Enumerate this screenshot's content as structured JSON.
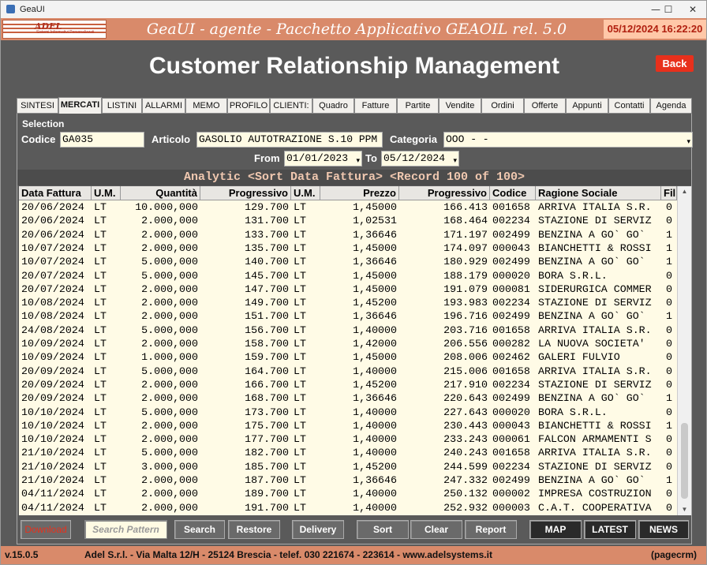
{
  "window": {
    "title": "GeaUI",
    "minimize": "—",
    "maximize": "☐",
    "close": "✕"
  },
  "header": {
    "logo_text": "ADEL",
    "logo_sub": "Sistemi Informativi Personalizzati",
    "app_title": "GeaUI - agente - Pacchetto Applicativo GEAOIL rel. 5.0",
    "datetime": "05/12/2024 16:22:20"
  },
  "page": {
    "title": "Customer Relationship Management",
    "back_label": "Back"
  },
  "tabs": [
    {
      "label": "SINTESI"
    },
    {
      "label": "MERCATI"
    },
    {
      "label": "LISTINI"
    },
    {
      "label": "ALLARMI"
    },
    {
      "label": "MEMO"
    },
    {
      "label": "PROFILO"
    },
    {
      "label": "CLIENTI:"
    },
    {
      "label": "Quadro"
    },
    {
      "label": "Fatture"
    },
    {
      "label": "Partite"
    },
    {
      "label": "Vendite"
    },
    {
      "label": "Ordini"
    },
    {
      "label": "Offerte"
    },
    {
      "label": "Appunti"
    },
    {
      "label": "Contatti"
    },
    {
      "label": "Agenda"
    }
  ],
  "selection": {
    "label": "Selection",
    "codice_label": "Codice",
    "codice_value": "GA035",
    "articolo_label": "Articolo",
    "articolo_value": "GASOLIO AUTOTRAZIONE S.10 PPM",
    "categoria_label": "Categoria",
    "categoria_value": "OOO - -",
    "from_label": "From",
    "from_value": "01/01/2023",
    "to_label": "To",
    "to_value": "05/12/2024"
  },
  "analytic_title": "Analytic <Sort Data Fattura> <Record 100 of 100>",
  "table": {
    "columns": [
      "Data Fattura",
      "U.M.",
      "Quantità",
      "Progressivo",
      "U.M.",
      "Prezzo",
      "Progressivo",
      "Codice",
      "Ragione Sociale",
      "Fil."
    ],
    "rows": [
      [
        "20/06/2024",
        "LT",
        "10.000,000",
        "129.700",
        "LT",
        "1,45000",
        "166.413",
        "001658",
        "ARRIVA ITALIA S.R.",
        "0"
      ],
      [
        "20/06/2024",
        "LT",
        "2.000,000",
        "131.700",
        "LT",
        "1,02531",
        "168.464",
        "002234",
        "STAZIONE DI SERVIZ",
        "0"
      ],
      [
        "20/06/2024",
        "LT",
        "2.000,000",
        "133.700",
        "LT",
        "1,36646",
        "171.197",
        "002499",
        "BENZINA A GO` GO`",
        "1"
      ],
      [
        "10/07/2024",
        "LT",
        "2.000,000",
        "135.700",
        "LT",
        "1,45000",
        "174.097",
        "000043",
        "BIANCHETTI & ROSSI",
        "1"
      ],
      [
        "10/07/2024",
        "LT",
        "5.000,000",
        "140.700",
        "LT",
        "1,36646",
        "180.929",
        "002499",
        "BENZINA A GO` GO`",
        "1"
      ],
      [
        "20/07/2024",
        "LT",
        "5.000,000",
        "145.700",
        "LT",
        "1,45000",
        "188.179",
        "000020",
        "BORA S.R.L.",
        "0"
      ],
      [
        "20/07/2024",
        "LT",
        "2.000,000",
        "147.700",
        "LT",
        "1,45000",
        "191.079",
        "000081",
        "SIDERURGICA COMMER",
        "0"
      ],
      [
        "10/08/2024",
        "LT",
        "2.000,000",
        "149.700",
        "LT",
        "1,45200",
        "193.983",
        "002234",
        "STAZIONE DI SERVIZ",
        "0"
      ],
      [
        "10/08/2024",
        "LT",
        "2.000,000",
        "151.700",
        "LT",
        "1,36646",
        "196.716",
        "002499",
        "BENZINA A GO` GO`",
        "1"
      ],
      [
        "24/08/2024",
        "LT",
        "5.000,000",
        "156.700",
        "LT",
        "1,40000",
        "203.716",
        "001658",
        "ARRIVA ITALIA S.R.",
        "0"
      ],
      [
        "10/09/2024",
        "LT",
        "2.000,000",
        "158.700",
        "LT",
        "1,42000",
        "206.556",
        "000282",
        "LA NUOVA SOCIETA'",
        "0"
      ],
      [
        "10/09/2024",
        "LT",
        "1.000,000",
        "159.700",
        "LT",
        "1,45000",
        "208.006",
        "002462",
        "GALERI FULVIO",
        "0"
      ],
      [
        "20/09/2024",
        "LT",
        "5.000,000",
        "164.700",
        "LT",
        "1,40000",
        "215.006",
        "001658",
        "ARRIVA ITALIA S.R.",
        "0"
      ],
      [
        "20/09/2024",
        "LT",
        "2.000,000",
        "166.700",
        "LT",
        "1,45200",
        "217.910",
        "002234",
        "STAZIONE DI SERVIZ",
        "0"
      ],
      [
        "20/09/2024",
        "LT",
        "2.000,000",
        "168.700",
        "LT",
        "1,36646",
        "220.643",
        "002499",
        "BENZINA A GO` GO`",
        "1"
      ],
      [
        "10/10/2024",
        "LT",
        "5.000,000",
        "173.700",
        "LT",
        "1,40000",
        "227.643",
        "000020",
        "BORA S.R.L.",
        "0"
      ],
      [
        "10/10/2024",
        "LT",
        "2.000,000",
        "175.700",
        "LT",
        "1,40000",
        "230.443",
        "000043",
        "BIANCHETTI & ROSSI",
        "1"
      ],
      [
        "10/10/2024",
        "LT",
        "2.000,000",
        "177.700",
        "LT",
        "1,40000",
        "233.243",
        "000061",
        "FALCON ARMAMENTI S",
        "0"
      ],
      [
        "21/10/2024",
        "LT",
        "5.000,000",
        "182.700",
        "LT",
        "1,40000",
        "240.243",
        "001658",
        "ARRIVA ITALIA S.R.",
        "0"
      ],
      [
        "21/10/2024",
        "LT",
        "3.000,000",
        "185.700",
        "LT",
        "1,45200",
        "244.599",
        "002234",
        "STAZIONE DI SERVIZ",
        "0"
      ],
      [
        "21/10/2024",
        "LT",
        "2.000,000",
        "187.700",
        "LT",
        "1,36646",
        "247.332",
        "002499",
        "BENZINA A GO` GO`",
        "1"
      ],
      [
        "04/11/2024",
        "LT",
        "2.000,000",
        "189.700",
        "LT",
        "1,40000",
        "250.132",
        "000002",
        "IMPRESA COSTRUZION",
        "0"
      ],
      [
        "04/11/2024",
        "LT",
        "2.000,000",
        "191.700",
        "LT",
        "1,40000",
        "252.932",
        "000003",
        "C.A.T. COOPERATIVA",
        "0"
      ]
    ]
  },
  "buttons": {
    "download": "Download",
    "search_pattern": "Search Pattern",
    "search": "Search",
    "restore": "Restore",
    "delivery": "Delivery",
    "sort": "Sort",
    "clear": "Clear",
    "report": "Report",
    "map": "MAP",
    "latest": "LATEST",
    "news": "NEWS"
  },
  "footer": {
    "version": "v.15.0.5",
    "company": "Adel S.r.l. - Via Malta 12/H - 25124 Brescia - telef. 030 221674 - 223614 - www.adelsystems.it",
    "page_id": "(pagecrm)"
  },
  "colors": {
    "accent": "#d98a6a",
    "back_button": "#e8301c",
    "datetime_text": "#b02010",
    "grid_bg": "#fffbe6"
  }
}
